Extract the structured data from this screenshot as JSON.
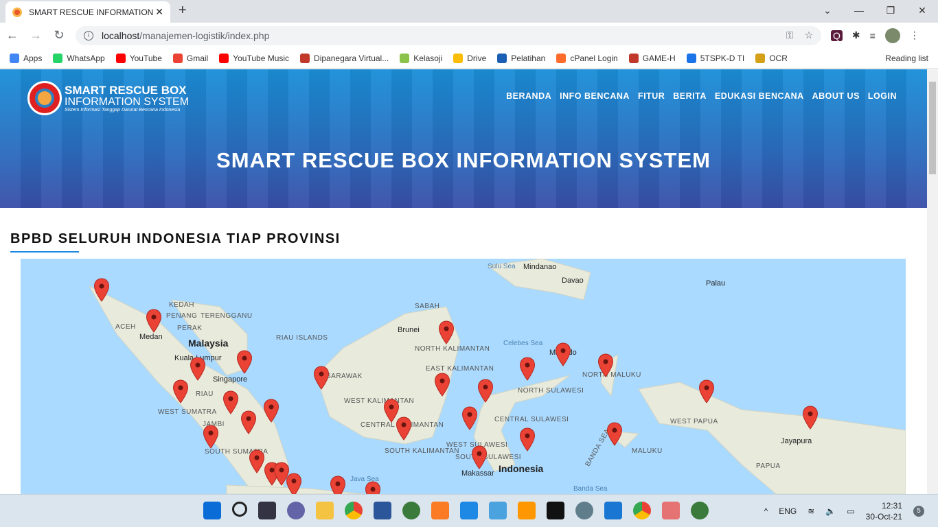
{
  "browser": {
    "tab_title": "SMART RESCUE INFORMATION",
    "url_host": "localhost",
    "url_path": "/manajemen-logistik/index.php",
    "bookmarks": [
      {
        "label": "Apps",
        "color": "#4285f4"
      },
      {
        "label": "WhatsApp",
        "color": "#25d366"
      },
      {
        "label": "YouTube",
        "color": "#ff0000"
      },
      {
        "label": "Gmail",
        "color": "#ea4335"
      },
      {
        "label": "YouTube Music",
        "color": "#ff0000"
      },
      {
        "label": "Dipanegara Virtual...",
        "color": "#c0392b"
      },
      {
        "label": "Kelasoji",
        "color": "#8bc34a"
      },
      {
        "label": "Drive",
        "color": "#fbbc04"
      },
      {
        "label": "Pelatihan",
        "color": "#1a5fb4"
      },
      {
        "label": "cPanel Login",
        "color": "#ff6c2c"
      },
      {
        "label": "GAME-H",
        "color": "#c0392b"
      },
      {
        "label": "5TSPK-D TI",
        "color": "#1a73e8"
      },
      {
        "label": "OCR",
        "color": "#d4a017"
      }
    ],
    "reading_list": "Reading list"
  },
  "site": {
    "logo": {
      "line1": "SMART RESCUE BOX",
      "line2": "INFORMATION SYSTEM",
      "tagline": "Sistem Informasi Tanggap Darurat Bencana Indonesia"
    },
    "menu": [
      "BERANDA",
      "INFO BENCANA",
      "FITUR",
      "BERITA",
      "EDUKASI BENCANA",
      "ABOUT US",
      "LOGIN"
    ],
    "hero_title": "SMART RESCUE BOX INFORMATION SYSTEM",
    "section_title": "BPBD SELURUH INDONESIA TIAP PROVINSI",
    "accent": "#1e88e5"
  },
  "map": {
    "water_color": "#aadaff",
    "marker_color": "#ea4335",
    "labels": [
      "Sulu Sea",
      "Mindanao",
      "Davao",
      "Palau",
      "KEDAH",
      "ACEH",
      "PENANG",
      "TERENGGANU",
      "PERAK",
      "Medan",
      "Malaysia",
      "Kuala Lumpur",
      "RIAU ISLANDS",
      "SABAH",
      "Brunei",
      "NORTH KALIMANTAN",
      "Celebes Sea",
      "Singapore",
      "RIAU",
      "WEST SUMATRA",
      "JAMBI",
      "SOUTH SUMATRA",
      "SARAWAK",
      "WEST KALIMANTAN",
      "CENTRAL KALIMANTAN",
      "SOUTH KALIMANTAN",
      "EAST KALIMANTAN",
      "Manado",
      "NORTH SULAWESI",
      "NORTH MALUKU",
      "CENTRAL SULAWESI",
      "WEST SULAWESI",
      "SOUTH SULAWESI",
      "Makassar",
      "Indonesia",
      "WEST PAPUA",
      "Jayapura",
      "PAPUA",
      "MALUKU",
      "BANDA SEA",
      "Banda Sea",
      "Java Sea"
    ]
  },
  "taskbar": {
    "language": "ENG",
    "time": "12:31",
    "date": "30-Oct-21",
    "notifications": "5"
  }
}
